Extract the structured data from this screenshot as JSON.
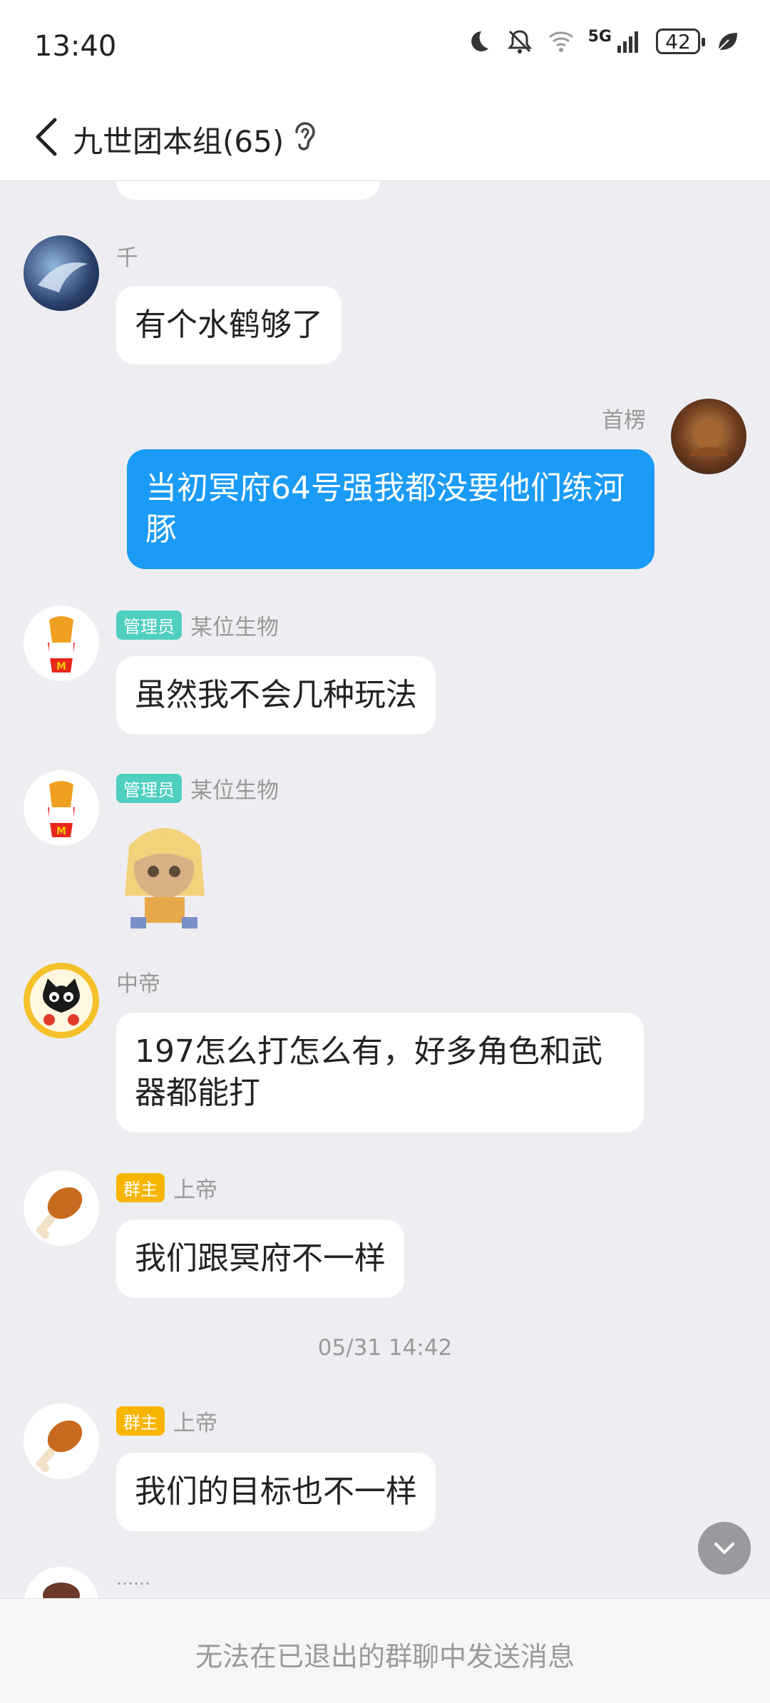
{
  "status_bar": {
    "time": "13:40",
    "network": "5G",
    "battery": "42",
    "icons": [
      "moon-icon",
      "mute-bell-icon",
      "wifi-icon",
      "signal-icon",
      "battery-icon",
      "leaf-icon"
    ]
  },
  "header": {
    "title": "九世团本组(65)"
  },
  "messages": [
    {
      "name": "千",
      "text": "有个水鹤够了"
    },
    {
      "name": "首楞",
      "text": "当初冥府64号强我都没要他们练河豚"
    },
    {
      "badge": "管理员",
      "name": "某位生物",
      "text": "虽然我不会几种玩法"
    },
    {
      "badge": "管理员",
      "name": "某位生物"
    },
    {
      "name": "中帝",
      "text": "197怎么打怎么有，好多角色和武器都能打"
    },
    {
      "badge": "群主",
      "name": "上帝",
      "text": "我们跟冥府不一样"
    },
    {
      "badge": "群主",
      "name": "上帝",
      "text": "我们的目标也不一样"
    },
    {
      "name": "……"
    }
  ],
  "timestamp": "05/31 14:42",
  "bottom_bar": {
    "notice": "无法在已退出的群聊中发送消息"
  },
  "colors": {
    "own_bubble": "#1a9bf8",
    "admin_badge": "#4fcfbf",
    "owner_badge": "#f7b500",
    "background": "#eeeef2"
  }
}
